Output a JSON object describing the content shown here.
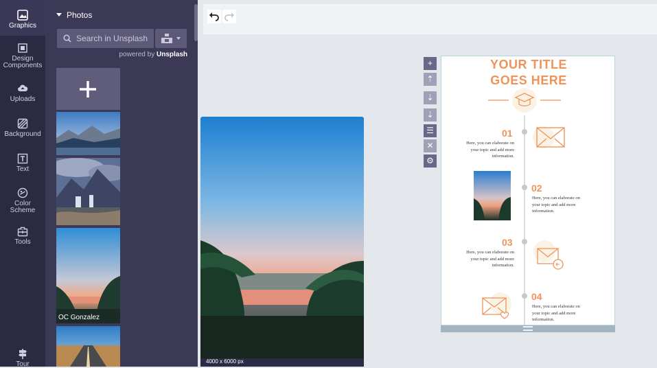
{
  "sidebar": {
    "items": [
      {
        "label": "Graphics",
        "icon": "image-icon"
      },
      {
        "label": "Design\nComponents",
        "icon": "components-icon"
      },
      {
        "label": "Uploads",
        "icon": "cloud-upload-icon"
      },
      {
        "label": "Background",
        "icon": "background-pattern-icon"
      },
      {
        "label": "Text",
        "icon": "text-box-icon"
      },
      {
        "label": "Color\nScheme",
        "icon": "palette-icon"
      },
      {
        "label": "Tools",
        "icon": "toolbox-icon"
      },
      {
        "label": "Tour",
        "icon": "signpost-icon"
      }
    ]
  },
  "photos_panel": {
    "section_title": "Photos",
    "search_placeholder": "Search in Unsplash",
    "powered_prefix": "powered by",
    "powered_brand": "Unsplash",
    "photo_credit": "OC Gonzalez"
  },
  "preview": {
    "dimensions": "4000 x 6000 px"
  },
  "infographic": {
    "title_line1": "YOUR TITLE",
    "title_line2": "GOES HERE",
    "steps": [
      {
        "number": "01",
        "text": "Here, you can elaborate on your topic and add more information."
      },
      {
        "number": "02",
        "text": "Here, you can elaborate on your topic and add more information."
      },
      {
        "number": "03",
        "text": "Here, you can elaborate on your topic and add more information."
      },
      {
        "number": "04",
        "text": "Here, you can elaborate on your topic and add more information."
      }
    ]
  },
  "colors": {
    "accent": "#f0935a",
    "rail_bg": "#2b2a43",
    "panel_bg": "#3b3955",
    "canvas_bg": "#e4e8ec"
  }
}
